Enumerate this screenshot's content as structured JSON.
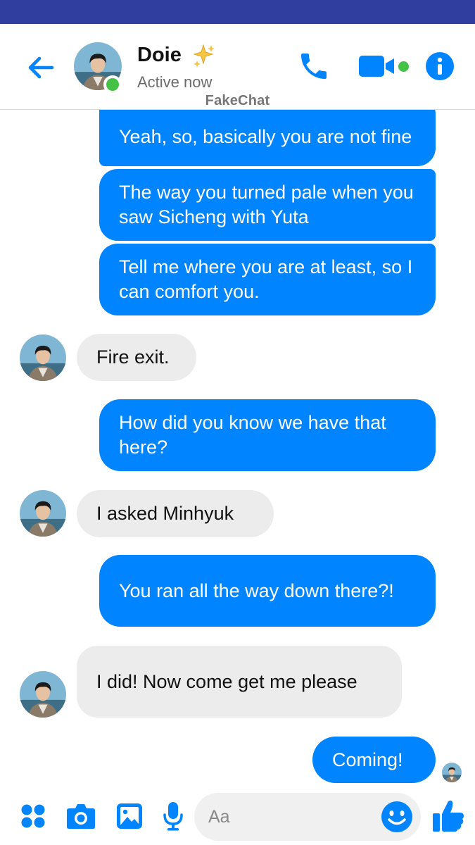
{
  "header": {
    "contact_name": "Doie",
    "status": "Active now",
    "watermark": "FakeChat",
    "icons": [
      "back-arrow-icon",
      "sparkles-icon",
      "phone-icon",
      "video-camera-icon",
      "info-icon"
    ]
  },
  "messages": [
    {
      "direction": "outgoing",
      "text": "Yeah, so, basically you are not fine"
    },
    {
      "direction": "outgoing",
      "text": "The way you turned pale when you saw Sicheng with Yuta"
    },
    {
      "direction": "outgoing",
      "text": "Tell me where you are at least, so I can comfort you."
    },
    {
      "direction": "incoming",
      "text": "Fire exit."
    },
    {
      "direction": "outgoing",
      "text": "How did you know we have that here?"
    },
    {
      "direction": "incoming",
      "text": "I asked Minhyuk"
    },
    {
      "direction": "outgoing",
      "text": "You ran all the way down there?!"
    },
    {
      "direction": "incoming",
      "text": "I did! Now come get me please"
    },
    {
      "direction": "outgoing",
      "text": "Coming!"
    }
  ],
  "composer": {
    "placeholder": "Aa",
    "icons": [
      "apps-icon",
      "camera-icon",
      "gallery-icon",
      "microphone-icon",
      "emoji-icon",
      "thumbs-up-icon"
    ]
  },
  "colors": {
    "accent": "#0084ff",
    "status_bar": "#303f9f",
    "incoming_bubble": "#ececec",
    "online": "#44c245"
  }
}
